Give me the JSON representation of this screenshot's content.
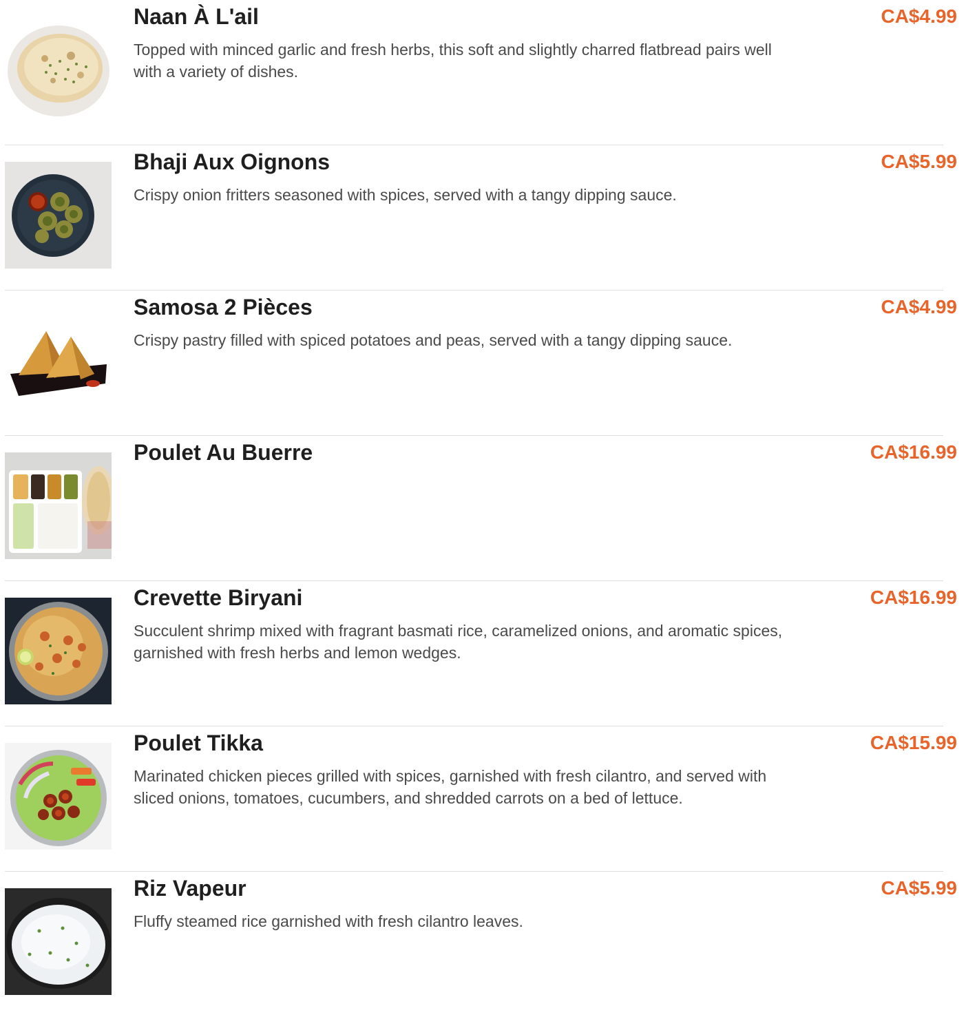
{
  "menu": {
    "items": [
      {
        "name": "Naan À L'ail",
        "description": "Topped with minced garlic and fresh herbs, this soft and slightly charred flatbread pairs well with a variety of dishes.",
        "price": "CA$4.99",
        "image_icon": "garlic-naan-photo"
      },
      {
        "name": "Bhaji Aux Oignons",
        "description": "Crispy onion fritters seasoned with spices, served with a tangy dipping sauce.",
        "price": "CA$5.99",
        "image_icon": "onion-bhaji-photo"
      },
      {
        "name": "Samosa 2 Pièces",
        "description": "Crispy pastry filled with spiced potatoes and peas, served with a tangy dipping sauce.",
        "price": "CA$4.99",
        "image_icon": "samosa-photo"
      },
      {
        "name": "Poulet Au Buerre",
        "description": "",
        "price": "CA$16.99",
        "image_icon": "butter-chicken-thali-photo"
      },
      {
        "name": "Crevette Biryani",
        "description": "Succulent shrimp mixed with fragrant basmati rice, caramelized onions, and aromatic spices, garnished with fresh herbs and lemon wedges.",
        "price": "CA$16.99",
        "image_icon": "shrimp-biryani-photo"
      },
      {
        "name": "Poulet Tikka",
        "description": "Marinated chicken pieces grilled with spices, garnished with fresh cilantro, and served with sliced onions, tomatoes, cucumbers, and shredded carrots on a bed of lettuce.",
        "price": "CA$15.99",
        "image_icon": "chicken-tikka-salad-photo"
      },
      {
        "name": "Riz Vapeur",
        "description": "Fluffy steamed rice garnished with fresh cilantro leaves.",
        "price": "CA$5.99",
        "image_icon": "steamed-rice-photo"
      }
    ],
    "colors": {
      "price": "#e8642a",
      "title": "#1f1f1f",
      "description": "#4a4a4a",
      "divider": "#dddddd"
    }
  }
}
